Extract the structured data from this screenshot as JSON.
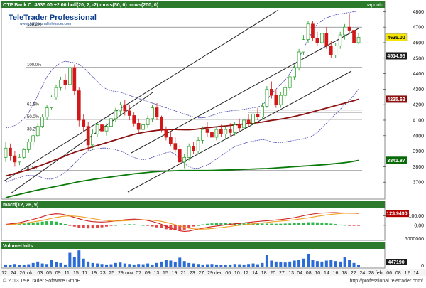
{
  "header": {
    "ticker_line": "OTP Bank  C: 4635.00  +2.00  boll(20, 2, -2)  movs(50, 0)  movs(200, 0)",
    "period": "napontu",
    "logo": "TeleTrader Professional",
    "logo_url": "www.professional.teletrader.com"
  },
  "footer": {
    "copyright": "© 2013 TeleTrader Software GmbH",
    "url": "http://professional.teletrader.com/"
  },
  "chart_data": [
    {
      "type": "line",
      "panel": "price",
      "ylim": [
        3600,
        4820
      ],
      "yticks": [
        3700,
        3800,
        3900,
        4000,
        4100,
        4200,
        4300,
        4400,
        4500,
        4600,
        4700,
        4800
      ],
      "last_price_label": "4635.00",
      "price_badges": [
        {
          "label": "4514.95",
          "value": 4514.95,
          "color": "#1a1a1a"
        },
        {
          "label": "4235.62",
          "value": 4235.62,
          "color": "#8b1010"
        },
        {
          "label": "3841.87",
          "value": 3841.87,
          "color": "#0a6a0a"
        }
      ],
      "fib_levels": [
        {
          "label": "138.2%",
          "value": 4700
        },
        {
          "label": "100.0%",
          "value": 4440
        },
        {
          "label": "61.8%",
          "value": 4185
        },
        {
          "label": "50.0%",
          "value": 4105
        },
        {
          "label": "38.2%",
          "value": 4025
        },
        {
          "label": "0.0%",
          "value": 3775
        }
      ],
      "candles": [
        [
          3860,
          3960,
          3830,
          3920
        ],
        [
          3920,
          3950,
          3840,
          3870
        ],
        [
          3870,
          3900,
          3800,
          3830
        ],
        [
          3830,
          3880,
          3810,
          3860
        ],
        [
          3860,
          3920,
          3850,
          3910
        ],
        [
          3910,
          3980,
          3890,
          3960
        ],
        [
          3960,
          4020,
          3930,
          4000
        ],
        [
          4000,
          4080,
          3990,
          4060
        ],
        [
          4060,
          4140,
          4050,
          4120
        ],
        [
          4120,
          4200,
          4100,
          4180
        ],
        [
          4180,
          4260,
          4170,
          4250
        ],
        [
          4250,
          4330,
          4230,
          4310
        ],
        [
          4310,
          4380,
          4290,
          4360
        ],
        [
          4360,
          4400,
          4300,
          4330
        ],
        [
          4330,
          4470,
          4320,
          4440
        ],
        [
          4440,
          4460,
          4260,
          4290
        ],
        [
          4290,
          4310,
          4060,
          4100
        ],
        [
          4100,
          4140,
          4030,
          4060
        ],
        [
          4060,
          4090,
          3900,
          3940
        ],
        [
          3940,
          4040,
          3920,
          4010
        ],
        [
          4010,
          4090,
          3990,
          4070
        ],
        [
          4070,
          4110,
          4010,
          4030
        ],
        [
          4030,
          4080,
          4000,
          4060
        ],
        [
          4060,
          4130,
          4040,
          4110
        ],
        [
          4110,
          4180,
          4090,
          4160
        ],
        [
          4160,
          4220,
          4130,
          4200
        ],
        [
          4200,
          4230,
          4130,
          4160
        ],
        [
          4160,
          4200,
          4100,
          4130
        ],
        [
          4130,
          4150,
          4060,
          4080
        ],
        [
          4080,
          4110,
          4020,
          4040
        ],
        [
          4040,
          4090,
          4020,
          4070
        ],
        [
          4070,
          4130,
          4050,
          4110
        ],
        [
          4110,
          4200,
          4090,
          4180
        ],
        [
          4180,
          4210,
          4100,
          4120
        ],
        [
          4120,
          4130,
          4020,
          4040
        ],
        [
          4040,
          4060,
          3970,
          3990
        ],
        [
          3990,
          4030,
          3930,
          3950
        ],
        [
          3950,
          3990,
          3890,
          3910
        ],
        [
          3910,
          3940,
          3810,
          3830
        ],
        [
          3830,
          3880,
          3790,
          3860
        ],
        [
          3860,
          3950,
          3840,
          3930
        ],
        [
          3930,
          3960,
          3880,
          3900
        ],
        [
          3900,
          3990,
          3880,
          3970
        ],
        [
          3970,
          4060,
          3950,
          4040
        ],
        [
          4040,
          4090,
          3990,
          4020
        ],
        [
          4020,
          4040,
          3960,
          3990
        ],
        [
          3990,
          4060,
          3970,
          4040
        ],
        [
          4040,
          4070,
          3990,
          4010
        ],
        [
          4010,
          4060,
          3980,
          4040
        ],
        [
          4040,
          4080,
          4000,
          4020
        ],
        [
          4020,
          4090,
          4000,
          4070
        ],
        [
          4070,
          4110,
          4030,
          4050
        ],
        [
          4050,
          4120,
          4040,
          4100
        ],
        [
          4100,
          4140,
          4060,
          4080
        ],
        [
          4080,
          4160,
          4060,
          4140
        ],
        [
          4140,
          4180,
          4100,
          4120
        ],
        [
          4120,
          4210,
          4110,
          4190
        ],
        [
          4190,
          4320,
          4180,
          4300
        ],
        [
          4300,
          4350,
          4240,
          4260
        ],
        [
          4260,
          4300,
          4180,
          4200
        ],
        [
          4200,
          4280,
          4180,
          4260
        ],
        [
          4260,
          4330,
          4240,
          4310
        ],
        [
          4310,
          4400,
          4290,
          4380
        ],
        [
          4380,
          4460,
          4360,
          4440
        ],
        [
          4440,
          4560,
          4420,
          4540
        ],
        [
          4540,
          4650,
          4520,
          4620
        ],
        [
          4620,
          4740,
          4600,
          4720
        ],
        [
          4720,
          4740,
          4610,
          4630
        ],
        [
          4630,
          4670,
          4580,
          4600
        ],
        [
          4600,
          4680,
          4580,
          4660
        ],
        [
          4660,
          4700,
          4560,
          4580
        ],
        [
          4580,
          4610,
          4500,
          4520
        ],
        [
          4520,
          4600,
          4500,
          4580
        ],
        [
          4580,
          4670,
          4560,
          4650
        ],
        [
          4650,
          4720,
          4620,
          4700
        ],
        [
          4700,
          4790,
          4660,
          4680
        ],
        [
          4680,
          4690,
          4560,
          4600
        ],
        [
          4600,
          4660,
          4590,
          4635
        ]
      ],
      "sma50": [
        3740,
        3748,
        3756,
        3764,
        3772,
        3781,
        3791,
        3801,
        3812,
        3823,
        3834,
        3846,
        3857,
        3869,
        3881,
        3892,
        3902,
        3911,
        3919,
        3928,
        3937,
        3946,
        3955,
        3964,
        3973,
        3982,
        3991,
        4000,
        4008,
        4015,
        4021,
        4026,
        4030,
        4034,
        4037,
        4039,
        4040,
        4040,
        4039,
        4038,
        4038,
        4040,
        4043,
        4047,
        4051,
        4054,
        4057,
        4060,
        4063,
        4066,
        4069,
        4072,
        4075,
        4078,
        4081,
        4084,
        4088,
        4093,
        4098,
        4102,
        4107,
        4112,
        4118,
        4124,
        4131,
        4138,
        4146,
        4154,
        4162,
        4170,
        4178,
        4186,
        4194,
        4202,
        4210,
        4218,
        4226,
        4235
      ],
      "sma200": [
        3600,
        3608,
        3615,
        3622,
        3629,
        3636,
        3643,
        3649,
        3655,
        3661,
        3667,
        3673,
        3679,
        3685,
        3691,
        3697,
        3703,
        3708,
        3713,
        3718,
        3722,
        3726,
        3730,
        3734,
        3738,
        3742,
        3746,
        3750,
        3754,
        3757,
        3760,
        3763,
        3766,
        3768,
        3770,
        3772,
        3773,
        3774,
        3775,
        3775,
        3775,
        3775,
        3775,
        3775,
        3775,
        3776,
        3777,
        3778,
        3779,
        3780,
        3781,
        3782,
        3783,
        3784,
        3785,
        3786,
        3787,
        3788,
        3790,
        3792,
        3794,
        3796,
        3798,
        3800,
        3802,
        3804,
        3806,
        3808,
        3810,
        3812,
        3814,
        3817,
        3820,
        3823,
        3826,
        3830,
        3835,
        3841
      ],
      "boll_upper": [
        4050,
        4055,
        4065,
        4085,
        4110,
        4150,
        4200,
        4260,
        4320,
        4380,
        4420,
        4450,
        4470,
        4480,
        4475,
        4470,
        4460,
        4440,
        4410,
        4380,
        4350,
        4320,
        4300,
        4290,
        4285,
        4280,
        4270,
        4260,
        4250,
        4240,
        4230,
        4220,
        4210,
        4200,
        4190,
        4180,
        4170,
        4160,
        4150,
        4140,
        4130,
        4120,
        4115,
        4115,
        4120,
        4130,
        4140,
        4150,
        4155,
        4160,
        4162,
        4165,
        4170,
        4175,
        4180,
        4185,
        4195,
        4230,
        4270,
        4300,
        4330,
        4360,
        4400,
        4450,
        4500,
        4560,
        4620,
        4680,
        4720,
        4740,
        4760,
        4770,
        4780,
        4785,
        4790,
        4795,
        4800,
        4805
      ],
      "boll_lower": [
        3700,
        3710,
        3720,
        3730,
        3740,
        3745,
        3745,
        3740,
        3730,
        3720,
        3720,
        3730,
        3745,
        3765,
        3790,
        3820,
        3850,
        3880,
        3900,
        3910,
        3915,
        3920,
        3920,
        3915,
        3910,
        3900,
        3890,
        3870,
        3860,
        3850,
        3845,
        3850,
        3860,
        3870,
        3880,
        3890,
        3895,
        3880,
        3850,
        3820,
        3800,
        3790,
        3790,
        3800,
        3810,
        3830,
        3850,
        3870,
        3890,
        3910,
        3930,
        3940,
        3950,
        3960,
        3965,
        3970,
        3975,
        3970,
        3960,
        3955,
        3955,
        3960,
        3965,
        3970,
        3975,
        3980,
        3990,
        4000,
        4020,
        4050,
        4080,
        4110,
        4140,
        4170,
        4200,
        4230,
        4260,
        4300
      ],
      "x_tick_labels": [
        "12",
        "24",
        "26",
        "okt.",
        "03",
        "05",
        "09",
        "11",
        "15",
        "17",
        "19",
        "23",
        "25",
        "29",
        "nov.",
        "07",
        "09",
        "13",
        "15",
        "19",
        "21",
        "23",
        "27",
        "29",
        "dec.",
        "06",
        "10",
        "12",
        "14",
        "18",
        "20",
        "27",
        "'13",
        "04",
        "08",
        "10",
        "14",
        "16",
        "18",
        "22",
        "24",
        "28",
        "febr.",
        "06",
        "08",
        "12",
        "14"
      ]
    },
    {
      "type": "line",
      "panel": "macd",
      "title": "macd(12, 26, 9)",
      "ylim": [
        -150,
        170
      ],
      "yticks": [
        100,
        0
      ],
      "value_label": "123.9490",
      "macd": [
        10,
        15,
        20,
        28,
        38,
        50,
        62,
        75,
        90,
        105,
        115,
        120,
        118,
        110,
        96,
        82,
        68,
        55,
        45,
        38,
        35,
        34,
        36,
        40,
        46,
        52,
        58,
        62,
        64,
        62,
        58,
        50,
        40,
        26,
        10,
        -10,
        -28,
        -45,
        -58,
        -64,
        -60,
        -50,
        -40,
        -30,
        -22,
        -14,
        -8,
        -2,
        4,
        10,
        15,
        20,
        25,
        30,
        35,
        40,
        44,
        48,
        52,
        56,
        60,
        66,
        72,
        80,
        90,
        100,
        110,
        118,
        124,
        128,
        130,
        132,
        132,
        130,
        128,
        126,
        125,
        124
      ],
      "signal": [
        5,
        8,
        12,
        16,
        21,
        28,
        35,
        43,
        52,
        62,
        72,
        82,
        90,
        96,
        98,
        96,
        92,
        86,
        78,
        70,
        62,
        55,
        50,
        46,
        45,
        46,
        48,
        51,
        54,
        56,
        57,
        56,
        53,
        48,
        41,
        31,
        19,
        6,
        -7,
        -19,
        -30,
        -37,
        -40,
        -40,
        -38,
        -34,
        -29,
        -24,
        -18,
        -12,
        -6,
        0,
        5,
        10,
        15,
        20,
        25,
        30,
        35,
        40,
        44,
        48,
        53,
        58,
        64,
        71,
        78,
        86,
        94,
        101,
        108,
        114,
        119,
        123,
        126,
        127,
        127,
        127
      ]
    },
    {
      "type": "bar",
      "panel": "volume",
      "title": "VolumeUnits",
      "yticks": [
        6000000,
        0
      ],
      "value_label": "447190",
      "volume": [
        600000,
        500000,
        700000,
        550000,
        480000,
        650000,
        900000,
        1200000,
        800000,
        700000,
        1500000,
        1100000,
        900000,
        600000,
        3000000,
        2200000,
        3500000,
        1800000,
        1200000,
        900000,
        800000,
        700000,
        600000,
        650000,
        900000,
        1000000,
        800000,
        700000,
        600000,
        700000,
        650000,
        800000,
        600000,
        900000,
        1200000,
        1500000,
        1400000,
        1100000,
        2000000,
        1300000,
        900000,
        800000,
        700000,
        600000,
        650000,
        700000,
        600000,
        500000,
        550000,
        600000,
        700000,
        650000,
        600000,
        700000,
        800000,
        650000,
        900000,
        2500000,
        1400000,
        1200000,
        1100000,
        1000000,
        1200000,
        1400000,
        1600000,
        1800000,
        2800000,
        1500000,
        1300000,
        1200000,
        1400000,
        1600000,
        1300000,
        1200000,
        2100000,
        1600000,
        900000,
        447190
      ]
    }
  ]
}
